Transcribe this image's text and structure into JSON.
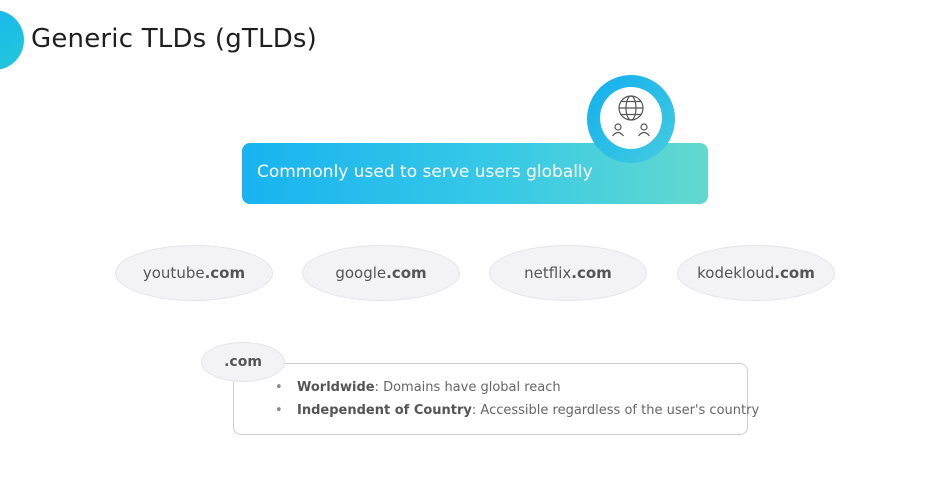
{
  "header": {
    "title": "Generic TLDs (gTLDs)"
  },
  "banner": {
    "text": "Commonly used to serve users globally",
    "icon": "globe-users-icon",
    "colors": {
      "start": "#18b3f0",
      "end": "#62d9cf"
    }
  },
  "domains": [
    {
      "name": "youtube",
      "tld": ".com"
    },
    {
      "name": "google",
      "tld": ".com"
    },
    {
      "name": "netflix",
      "tld": ".com"
    },
    {
      "name": "kodekloud",
      "tld": ".com"
    }
  ],
  "info": {
    "tag": ".com",
    "bullets": [
      {
        "bullet": "•",
        "term": "Worldwide",
        "text": ": Domains have global reach"
      },
      {
        "bullet": "•",
        "term": "Independent of Country",
        "text": ": Accessible regardless of the user's country"
      }
    ]
  }
}
